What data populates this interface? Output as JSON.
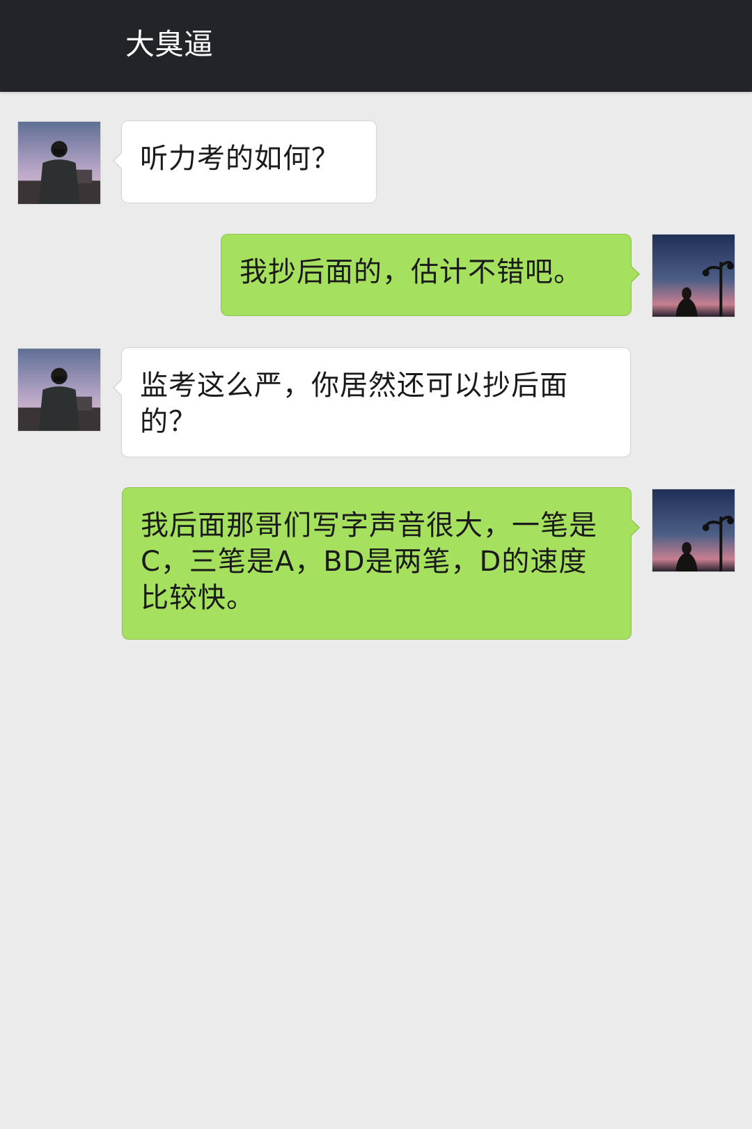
{
  "header": {
    "title": "大臭逼"
  },
  "messages": [
    {
      "sender": "contact",
      "avatar": "contact-avatar",
      "text": "听力考的如何？"
    },
    {
      "sender": "self",
      "avatar": "self-avatar",
      "text": "我抄后面的，估计不错吧。"
    },
    {
      "sender": "contact",
      "avatar": "contact-avatar",
      "text": "监考这么严，你居然还可以抄后面的？"
    },
    {
      "sender": "self",
      "avatar": "self-avatar",
      "text": "我后面那哥们写字声音很大，一笔是C，三笔是A，BD是两笔，D的速度比较快。"
    }
  ],
  "colors": {
    "header_bg": "#22242a",
    "chat_bg": "#ebebeb",
    "incoming_bubble": "#ffffff",
    "outgoing_bubble": "#a6e05f"
  }
}
